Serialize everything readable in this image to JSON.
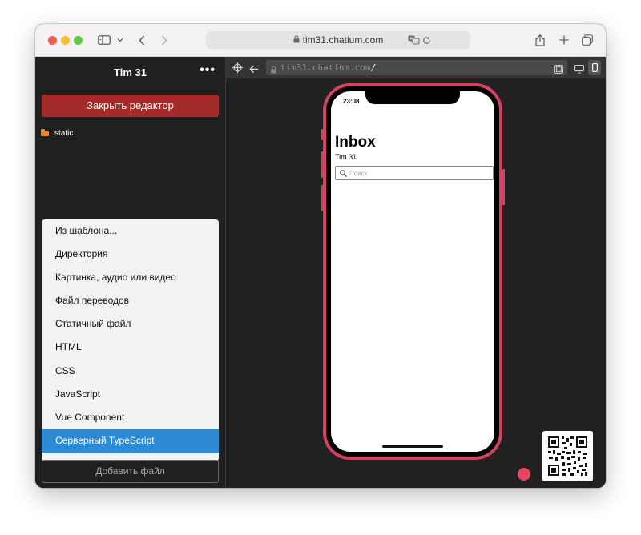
{
  "browser": {
    "url": "tim31.chatium.com"
  },
  "sidebar": {
    "title": "Tim 31",
    "more": "•••",
    "close_editor": "Закрыть редактор",
    "tree": [
      {
        "label": "static",
        "icon": "folder-icon"
      }
    ],
    "menu": [
      {
        "label": "Из шаблона...",
        "active": false
      },
      {
        "label": "Директория",
        "active": false
      },
      {
        "label": "Картинка, аудио или видео",
        "active": false
      },
      {
        "label": "Файл переводов",
        "active": false
      },
      {
        "label": "Статичный файл",
        "active": false
      },
      {
        "label": "HTML",
        "active": false
      },
      {
        "label": "CSS",
        "active": false
      },
      {
        "label": "JavaScript",
        "active": false
      },
      {
        "label": "Vue Component",
        "active": false
      },
      {
        "label": "Серверный TypeScript",
        "active": true
      }
    ],
    "add_file": "Добавить файл"
  },
  "preview": {
    "url_host": "tim31.chatium.com",
    "url_slash": "/",
    "phone": {
      "time": "23:08",
      "title": "Inbox",
      "subtitle": "Tim 31",
      "search_placeholder": "Поиск"
    }
  },
  "colors": {
    "close_button": "#a52b2b",
    "menu_active": "#2d8bd5",
    "phone_frame": "#d44262",
    "record_dot": "#e5455f"
  }
}
